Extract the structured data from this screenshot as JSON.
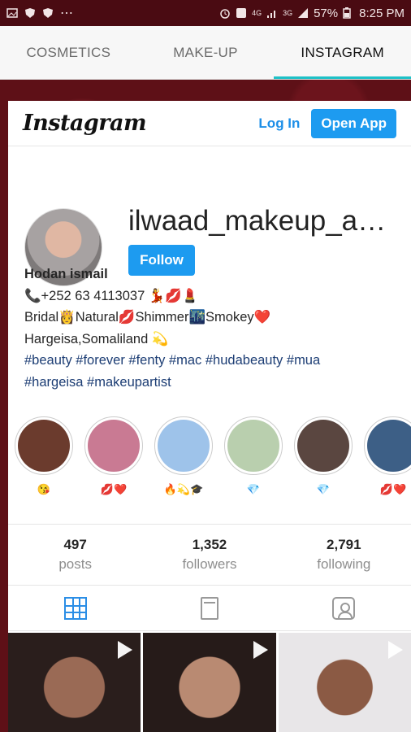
{
  "status_bar": {
    "battery": "57%",
    "time": "8:25 PM",
    "network": "4G",
    "network2": "3G"
  },
  "tabs": [
    {
      "label": "COSMETICS"
    },
    {
      "label": "MAKE-UP"
    },
    {
      "label": "INSTAGRAM"
    }
  ],
  "header": {
    "logo": "Instagram",
    "login": "Log In",
    "open_app": "Open App"
  },
  "profile": {
    "username": "ilwaad_makeup_a…",
    "follow": "Follow",
    "name": "Hodan ismail",
    "bio_lines": [
      "📞+252 63 4113037 💃💋💄",
      "Bridal👸Natural💋Shimmer🌃Smokey❤️",
      "Hargeisa,Somaliland 💫"
    ],
    "hashtags": [
      "#beauty #forever #fenty #mac #hudabeauty #mua",
      "#hargeisa #makeupartist"
    ]
  },
  "stories": [
    {
      "caption": "😘",
      "color": "#6b3b2d"
    },
    {
      "caption": "💋❤️",
      "color": "#c97a93"
    },
    {
      "caption": "🔥💫🎓",
      "color": "#9ec3ea"
    },
    {
      "caption": "💎",
      "color": "#b9cfae"
    },
    {
      "caption": "💎",
      "color": "#5a4640"
    },
    {
      "caption": "💋❤️",
      "color": "#3d5f86"
    }
  ],
  "stats": [
    {
      "value": "497",
      "label": "posts"
    },
    {
      "value": "1,352",
      "label": "followers"
    },
    {
      "value": "2,791",
      "label": "following"
    }
  ],
  "posts": [
    {
      "color": "#7a5a4a"
    },
    {
      "color": "#8a6a58"
    },
    {
      "color": "#6b4c42"
    }
  ],
  "colors": {
    "accent": "#1ec1c7",
    "ig_blue": "#1d9bf0",
    "hashtag": "#1c3d74"
  }
}
